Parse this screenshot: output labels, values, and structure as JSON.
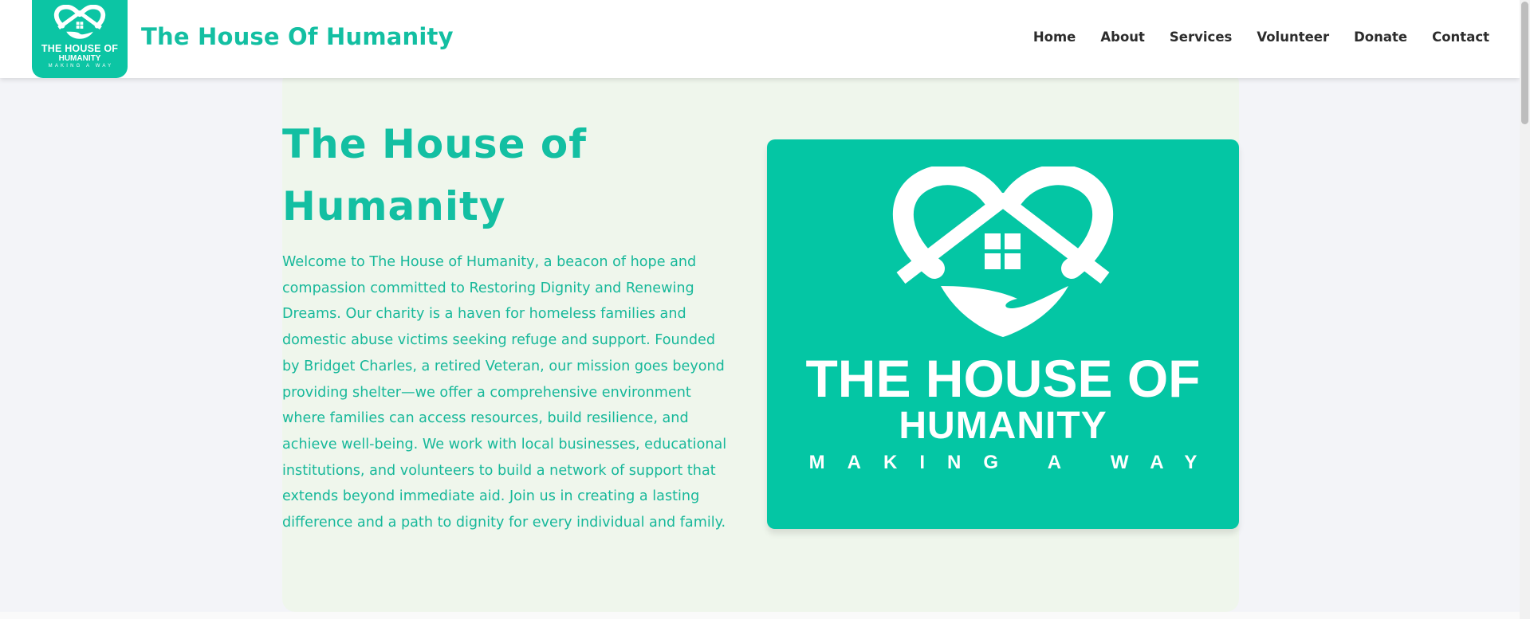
{
  "header": {
    "logo": {
      "line1": "THE HOUSE OF",
      "line2": "HUMANITY",
      "line3": "MAKING A WAY",
      "icon": "heart-house-hand-icon"
    },
    "site_title": "The House Of Humanity",
    "nav": [
      "Home",
      "About",
      "Services",
      "Volunteer",
      "Donate",
      "Contact"
    ]
  },
  "hero": {
    "title": "The House of Humanity",
    "text": "Welcome to The House of Humanity, a beacon of hope and compassion committed to Restoring Dignity and Renewing Dreams. Our charity is a haven for homeless families and domestic abuse victims seeking refuge and support. Founded by Bridget Charles, a retired Veteran, our mission goes beyond providing shelter—we offer a comprehensive environment where families can access resources, build resilience, and achieve well-being. We work with local businesses, educational institutions, and volunteers to build a network of support that extends beyond immediate aid. Join us in creating a lasting difference and a path to dignity for every individual and family.",
    "image": {
      "line1": "THE HOUSE OF",
      "line2": "HUMANITY",
      "line3": "MAKING A WAY",
      "icon": "heart-house-hand-icon"
    }
  },
  "colors": {
    "brand": "#13bfa2",
    "logo_bg": "#04c6a4",
    "hero_bg": "#eff6ec",
    "page_bg": "#f3f4f8",
    "nav_text": "#2c2c2c"
  }
}
